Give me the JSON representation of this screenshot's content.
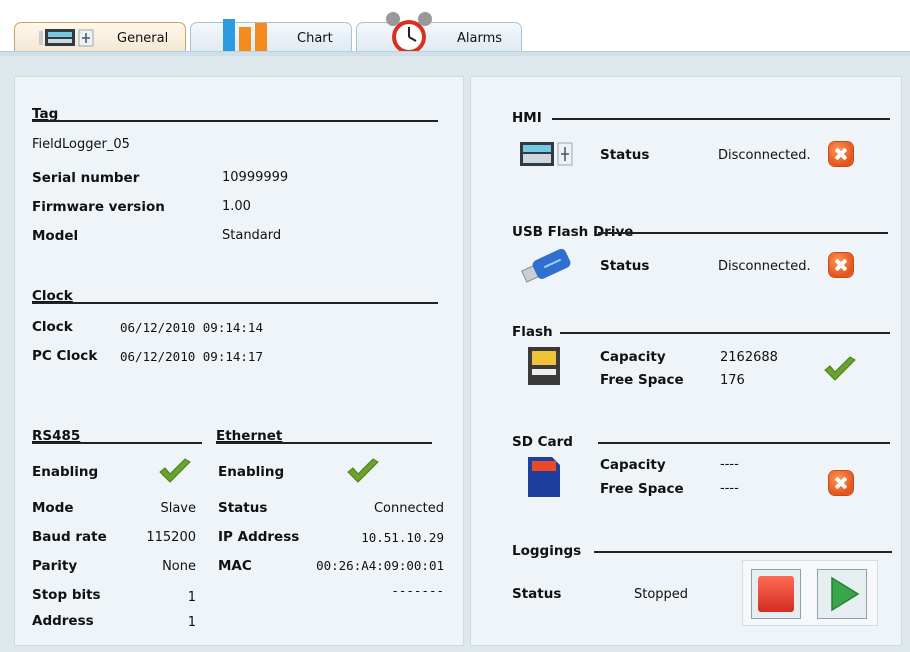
{
  "tabs": [
    {
      "label": "General",
      "icon": "hmi-device-icon"
    },
    {
      "label": "Chart",
      "icon": "bar-chart-icon"
    },
    {
      "label": "Alarms",
      "icon": "alarm-clock-icon"
    }
  ],
  "general": {
    "tag": {
      "title": "Tag",
      "value": "FieldLogger_05"
    },
    "serial": {
      "label": "Serial number",
      "value": "10999999"
    },
    "firmware": {
      "label": "Firmware version",
      "value": "1.00"
    },
    "model": {
      "label": "Model",
      "value": "Standard"
    },
    "clock": {
      "title": "Clock",
      "clock_label": "Clock",
      "clock_value": "06/12/2010 09:14:14",
      "pc_label": "PC Clock",
      "pc_value": "06/12/2010 09:14:17"
    },
    "rs485": {
      "title": "RS485",
      "enabling_label": "Enabling",
      "enabled": true,
      "rows": [
        {
          "label": "Mode",
          "value": "Slave"
        },
        {
          "label": "Baud rate",
          "value": "115200"
        },
        {
          "label": "Parity",
          "value": "None"
        },
        {
          "label": "Stop bits",
          "value": "1"
        },
        {
          "label": "Address",
          "value": "1"
        }
      ]
    },
    "ethernet": {
      "title": "Ethernet",
      "enabling_label": "Enabling",
      "enabled": true,
      "rows": [
        {
          "label": "Status",
          "value": "Connected"
        },
        {
          "label": "IP Address",
          "value": "10.51.10.29"
        },
        {
          "label": "MAC",
          "value": "00:26:A4:09:00:01"
        },
        {
          "label": "",
          "value": "-------"
        }
      ]
    }
  },
  "devices": {
    "hmi": {
      "title": "HMI",
      "status_label": "Status",
      "status_value": "Disconnected.",
      "ok": false
    },
    "usb": {
      "title": "USB Flash Drive",
      "status_label": "Status",
      "status_value": "Disconnected.",
      "ok": false
    },
    "flash": {
      "title": "Flash",
      "capacity_label": "Capacity",
      "capacity_value": "2162688",
      "free_label": "Free Space",
      "free_value": "176",
      "ok": true
    },
    "sd": {
      "title": "SD Card",
      "capacity_label": "Capacity",
      "capacity_value": "----",
      "free_label": "Free Space",
      "free_value": "----",
      "ok": false
    },
    "loggings": {
      "title": "Loggings",
      "status_label": "Status",
      "status_value": "Stopped"
    }
  },
  "colors": {
    "ok": "#6aa329",
    "error": "#e2561e",
    "stop": "#e03a2c",
    "play": "#3aa64a"
  }
}
